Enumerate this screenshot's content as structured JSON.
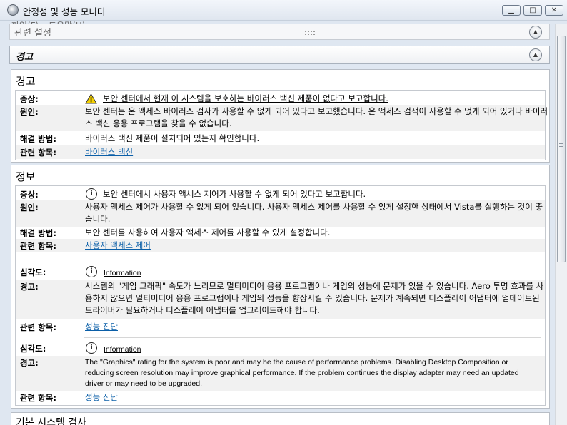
{
  "window": {
    "title": "안정성 및 성능 모니터",
    "minimize": "▁",
    "maximize": "□",
    "close": "✕"
  },
  "menu": {
    "file": "파일(F)",
    "help": "도움말(H)"
  },
  "cut_section_title": "관련 설정",
  "warning_section": {
    "title": "경고"
  },
  "warning_panel": {
    "title": "경고",
    "items": [
      {
        "symptom_label": "증상:",
        "symptom": "보안 센터에서 현재 이 시스템을 보호하는 바이러스 백신 제품이 없다고 보고합니다.",
        "cause_label": "원인:",
        "cause": "보안 센터는 온 액세스 바이러스 검사가 사용할 수 없게 되어 있다고 보고했습니다. 온 액세스 검색이 사용할 수 없게 되어 있거나 바이러스 백신 응용 프로그램을 찾을 수 없습니다.",
        "resolution_label": "해결 방법:",
        "resolution": "바이러스 백신 제품이 설치되어 있는지 확인합니다.",
        "related_label": "관련 항목:",
        "related": "바이러스 백신"
      }
    ]
  },
  "info_panel": {
    "title": "정보",
    "item": {
      "symptom_label": "증상:",
      "symptom": "보안 센터에서 사용자 액세스 제어가 사용할 수 없게 되어 있다고 보고합니다.",
      "cause_label": "원인:",
      "cause": "사용자 액세스 제어가 사용할 수 없게 되어 있습니다. 사용자 액세스 제어를 사용할 수 있게 설정한 상태에서 Vista를 실행하는 것이 좋습니다.",
      "resolution_label": "해결 방법:",
      "resolution": "보안 센터를 사용하여 사용자 액세스 제어를 사용할 수 있게 설정합니다.",
      "related_label": "관련 항목:",
      "related": "사용자 액세스 제어"
    },
    "severity_items": [
      {
        "severity_label": "심각도:",
        "severity": "Information",
        "warning_label": "경고:",
        "warning": "시스템의 \"게임 그래픽\" 속도가 느리므로 멀티미디어 응용 프로그램이나 게임의 성능에 문제가 있을 수 있습니다. Aero 투명 효과를 사용하지 않으면 멀티미디어 응용 프로그램이나 게임의 성능을 향상시킬 수 있습니다. 문제가 계속되면 디스플레이 어댑터에 업데이트된 드라이버가 필요하거나 디스플레이 어댑터를 업그레이드해야 합니다.",
        "related_label": "관련 항목:",
        "related": "성능 진단"
      },
      {
        "severity_label": "심각도:",
        "severity": "Information",
        "warning_label": "경고:",
        "warning": "The \"Graphics\" rating for the system is poor and may be the cause of performance problems. Disabling Desktop Composition or reducing screen resolution may improve graphical performance. If the problem continues the display adapter may need an updated driver or may need to be upgraded.",
        "related_label": "관련 항목:",
        "related": "성능 진단"
      }
    ]
  },
  "next_section_title": "기본 시스템 검사",
  "colors": {
    "link": "#0b5fa8",
    "warn": "#f4d000",
    "shade": "#f1f1f1"
  },
  "icons": {
    "warning": "warning-triangle-icon",
    "info": "info-circle-icon",
    "collapse": "chevron-up-icon"
  }
}
